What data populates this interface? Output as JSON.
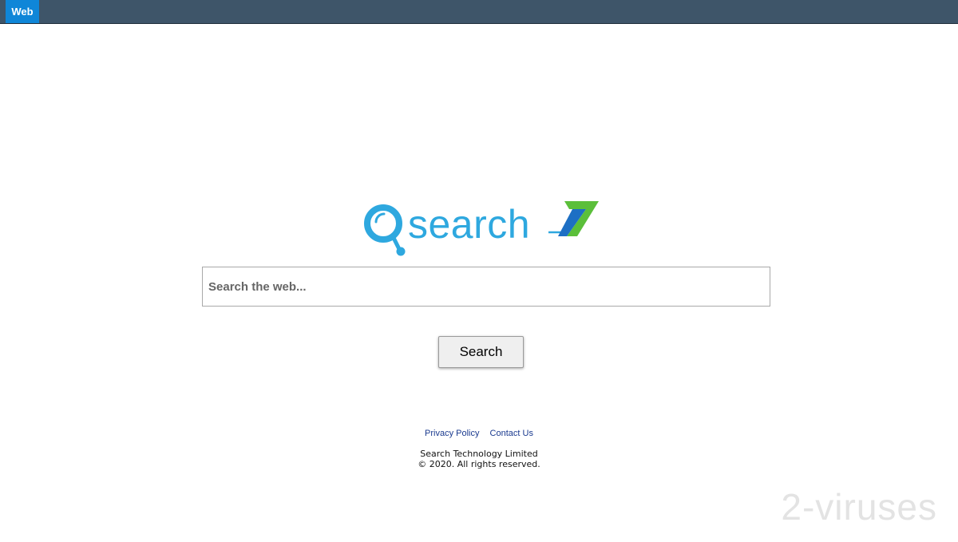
{
  "topbar": {
    "tabs": [
      {
        "label": "Web",
        "active": true
      }
    ]
  },
  "logo": {
    "text": "search",
    "suffix": "7",
    "colors": {
      "primary": "#2ea8df",
      "accent_green": "#5bbf3a",
      "accent_blue": "#1d6fc4"
    }
  },
  "search": {
    "placeholder": "Search the web...",
    "value": "",
    "button_label": "Search"
  },
  "footer": {
    "links": [
      "Privacy Policy",
      "Contact Us"
    ],
    "company": "Search Technology Limited",
    "copyright": "© 2020. All rights reserved."
  },
  "watermark": {
    "text": "2-viruses"
  },
  "colors": {
    "topbar_bg": "#3e5569",
    "tab_active_bg": "#0f86d8",
    "link": "#1a3a8f"
  }
}
